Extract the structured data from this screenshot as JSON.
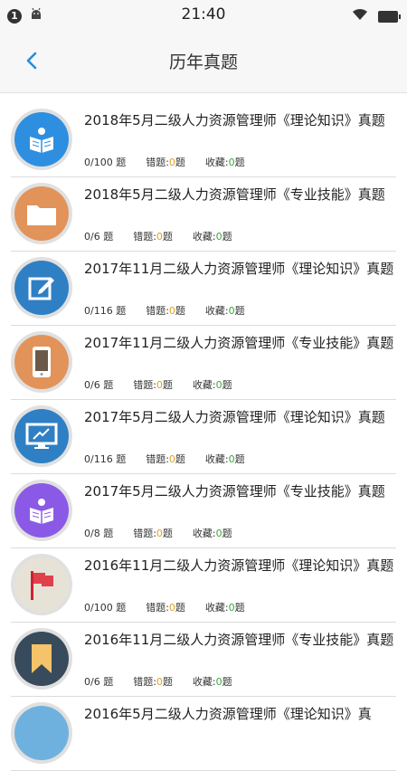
{
  "status": {
    "badge": "1",
    "time": "21:40"
  },
  "header": {
    "title": "历年真题"
  },
  "labels": {
    "questions_unit": "题",
    "wrong": "错题:",
    "collect": "收藏:"
  },
  "items": [
    {
      "title": "2018年5月二级人力资源管理师《理论知识》真题",
      "progress": "0/100",
      "wrong": "0",
      "wrong_unit": "题",
      "collect": "0",
      "collect_unit": "题",
      "icon": "reading-book-icon",
      "color": "#2e8fe0"
    },
    {
      "title": "2018年5月二级人力资源管理师《专业技能》真题",
      "progress": "0/6",
      "wrong": "0",
      "wrong_unit": "题",
      "collect": "0",
      "collect_unit": "题",
      "icon": "folder-icon",
      "color": "#e2935a"
    },
    {
      "title": "2017年11月二级人力资源管理师《理论知识》真题",
      "progress": "0/116",
      "wrong": "0",
      "wrong_unit": "题",
      "collect": "0",
      "collect_unit": "题",
      "icon": "edit-icon",
      "color": "#2f7fc4"
    },
    {
      "title": "2017年11月二级人力资源管理师《专业技能》真题",
      "progress": "0/6",
      "wrong": "0",
      "wrong_unit": "题",
      "collect": "0",
      "collect_unit": "题",
      "icon": "phone-icon",
      "color": "#e2935a"
    },
    {
      "title": "2017年5月二级人力资源管理师《理论知识》真题",
      "progress": "0/116",
      "wrong": "0",
      "wrong_unit": "题",
      "collect": "0",
      "collect_unit": "题",
      "icon": "monitor-icon",
      "color": "#2f7fc4"
    },
    {
      "title": "2017年5月二级人力资源管理师《专业技能》真题",
      "progress": "0/8",
      "wrong": "0",
      "wrong_unit": "题",
      "collect": "0",
      "collect_unit": "题",
      "icon": "reading-book-icon",
      "color": "#8a5ae6"
    },
    {
      "title": "2016年11月二级人力资源管理师《理论知识》真题",
      "progress": "0/100",
      "wrong": "0",
      "wrong_unit": "题",
      "collect": "0",
      "collect_unit": "题",
      "icon": "flag-icon",
      "color": "#e7e2d6"
    },
    {
      "title": "2016年11月二级人力资源管理师《专业技能》真题",
      "progress": "0/6",
      "wrong": "0",
      "wrong_unit": "题",
      "collect": "0",
      "collect_unit": "题",
      "icon": "bookmark-icon",
      "color": "#384b5c"
    },
    {
      "title": "2016年5月二级人力资源管理师《理论知识》真",
      "progress": "",
      "wrong": "",
      "wrong_unit": "",
      "collect": "",
      "collect_unit": "",
      "icon": "partial-icon",
      "color": "#6fb1de"
    }
  ]
}
